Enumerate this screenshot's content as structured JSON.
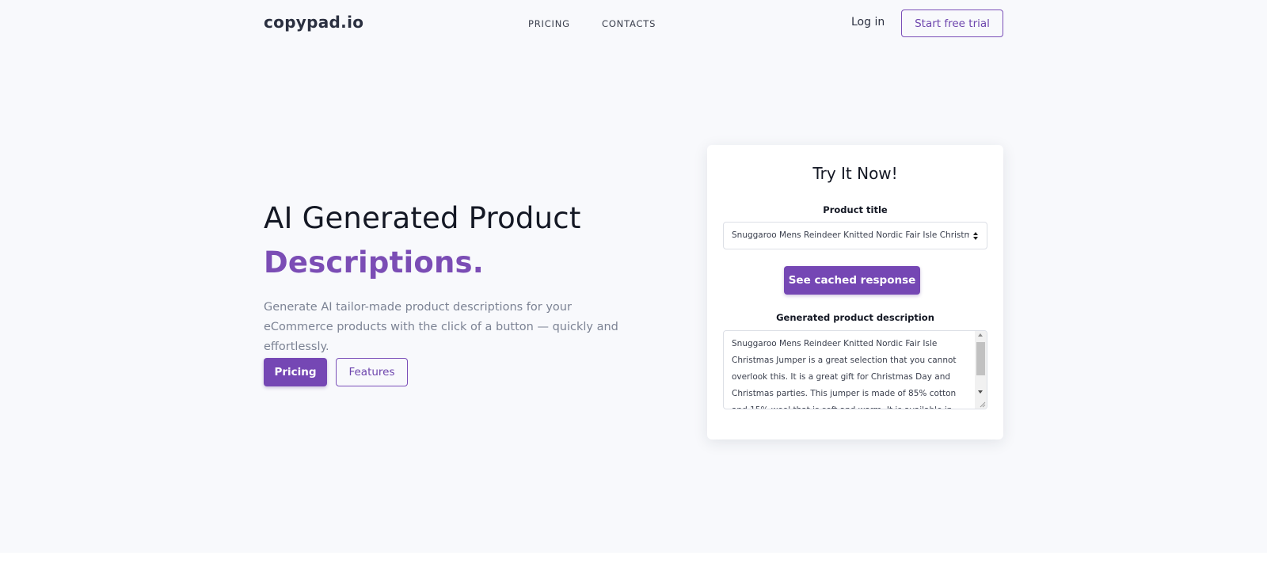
{
  "header": {
    "brand": "copypad.io",
    "nav": {
      "pricing": "PRICING",
      "contacts": "CONTACTS"
    },
    "login": "Log in",
    "trial_button": "Start free trial"
  },
  "hero": {
    "title_line1": "AI Generated Product",
    "title_line2": "Descriptions.",
    "description": "Generate AI tailor-made product descriptions for your eCommerce products with the click of a button — quickly and effortlessly.",
    "buttons": {
      "pricing": "Pricing",
      "features": "Features"
    }
  },
  "try_card": {
    "title": "Try It Now!",
    "product_title_label": "Product title",
    "product_title_value": "Snuggaroo Mens Reindeer Knitted Nordic Fair Isle Christmas",
    "cached_button": "See cached response",
    "generated_label": "Generated product description",
    "generated_text": "Snuggaroo Mens Reindeer Knitted Nordic Fair Isle Christmas Jumper is a great selection that you cannot overlook this. It is a great gift for Christmas Day and Christmas parties. This jumper is made of 85% cotton and 15% wool that is soft and warm. It is available in black and charcoal. It is a perfect"
  },
  "colors": {
    "accent": "#7547b4",
    "accent_text": "#7b4db5",
    "page_background": "#f8f9fc",
    "card_background": "#ffffff",
    "muted_text": "#7c8394"
  },
  "icons": {
    "select_arrows": "sort-arrows-icon",
    "scroll_up": "scroll-up-arrow-icon",
    "scroll_down": "scroll-down-arrow-icon",
    "resize": "resize-grip-icon"
  }
}
